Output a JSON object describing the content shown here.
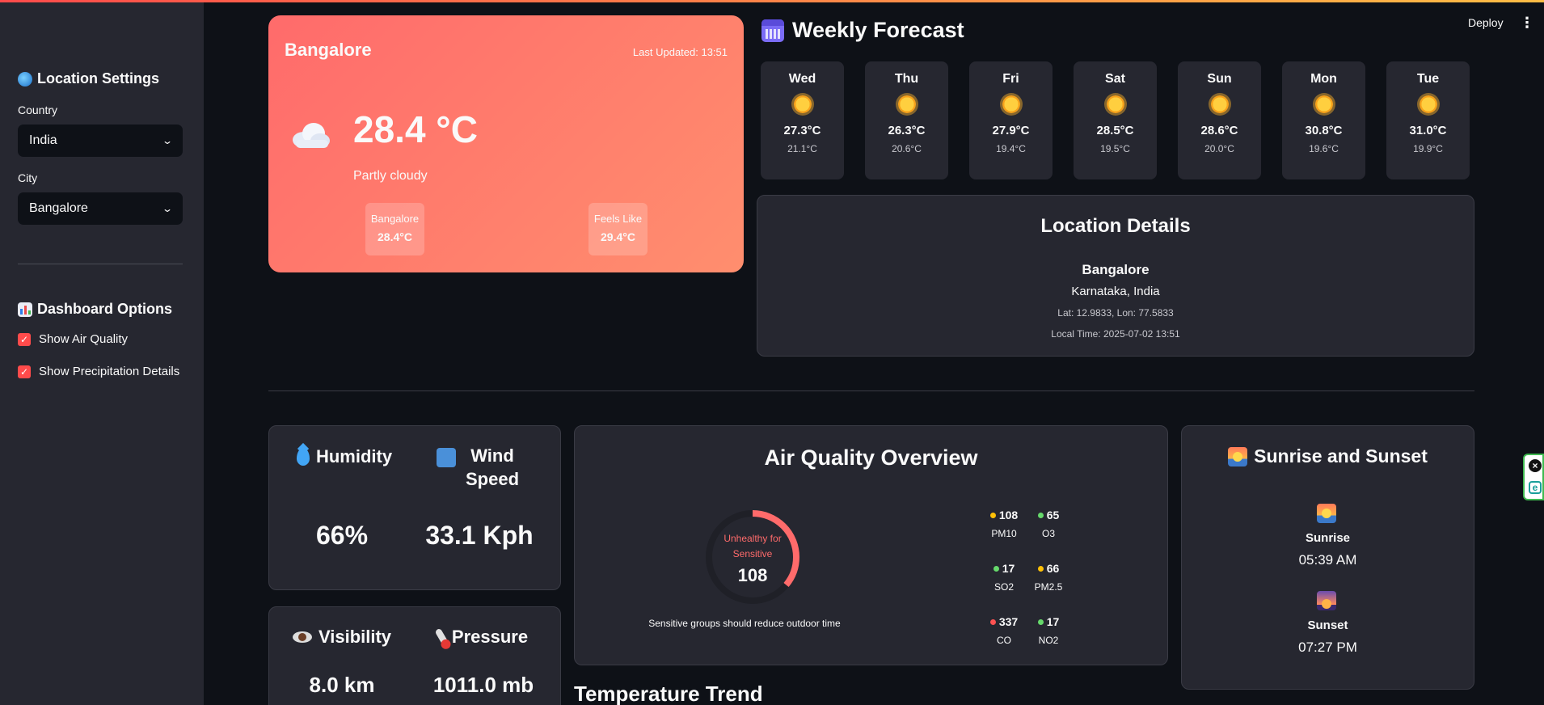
{
  "header": {
    "deploy_label": "Deploy",
    "menu_icon": "⋮"
  },
  "sidebar": {
    "location_heading": "Location Settings",
    "country_label": "Country",
    "country_value": "India",
    "city_label": "City",
    "city_value": "Bangalore",
    "dashboard_heading": "Dashboard Options",
    "options": [
      {
        "label": "Show Air Quality",
        "checked": true
      },
      {
        "label": "Show Precipitation Details",
        "checked": true
      }
    ]
  },
  "current": {
    "city": "Bangalore",
    "last_updated": "Last Updated: 13:51",
    "temperature": "28.4 °C",
    "condition": "Partly cloudy",
    "mini": [
      {
        "label": "Bangalore",
        "value": "28.4°C"
      },
      {
        "label": "Feels Like",
        "value": "29.4°C"
      }
    ]
  },
  "forecast": {
    "title": "Weekly Forecast",
    "days": [
      {
        "day": "Wed",
        "high": "27.3°C",
        "low": "21.1°C"
      },
      {
        "day": "Thu",
        "high": "26.3°C",
        "low": "20.6°C"
      },
      {
        "day": "Fri",
        "high": "27.9°C",
        "low": "19.4°C"
      },
      {
        "day": "Sat",
        "high": "28.5°C",
        "low": "19.5°C"
      },
      {
        "day": "Sun",
        "high": "28.6°C",
        "low": "20.0°C"
      },
      {
        "day": "Mon",
        "high": "30.8°C",
        "low": "19.6°C"
      },
      {
        "day": "Tue",
        "high": "31.0°C",
        "low": "19.9°C"
      }
    ]
  },
  "location": {
    "title": "Location Details",
    "city": "Bangalore",
    "region": "Karnataka, India",
    "latlon": "Lat: 12.9833, Lon: 77.5833",
    "local_time": "Local Time: 2025-07-02 13:51"
  },
  "metrics1": {
    "humidity_label": "Humidity",
    "humidity_value": "66%",
    "wind_label": "Wind Speed",
    "wind_value": "33.1 Kph"
  },
  "metrics2": {
    "visibility_label": "Visibility",
    "visibility_value": "8.0 km",
    "pressure_label": "Pressure",
    "pressure_value": "1011.0 mb"
  },
  "air_quality": {
    "title": "Air Quality Overview",
    "status": "Unhealthy for Sensitive",
    "aqi": "108",
    "aqi_fraction": 0.36,
    "note": "Sensitive groups should reduce outdoor time",
    "colors": {
      "yellow": "#ffc107",
      "green": "#66d96b",
      "red": "#ff5252",
      "gauge": "#ff6b6b"
    },
    "pollutants": [
      {
        "value": "108",
        "name": "PM10",
        "color": "yellow"
      },
      {
        "value": "65",
        "name": "O3",
        "color": "green"
      },
      {
        "value": "17",
        "name": "SO2",
        "color": "green"
      },
      {
        "value": "66",
        "name": "PM2.5",
        "color": "yellow"
      },
      {
        "value": "337",
        "name": "CO",
        "color": "red"
      },
      {
        "value": "17",
        "name": "NO2",
        "color": "green"
      }
    ]
  },
  "sun": {
    "title": "Sunrise and Sunset",
    "sunrise_label": "Sunrise",
    "sunrise_time": "05:39 AM",
    "sunset_label": "Sunset",
    "sunset_time": "07:27 PM"
  },
  "trend": {
    "title": "Temperature Trend"
  }
}
